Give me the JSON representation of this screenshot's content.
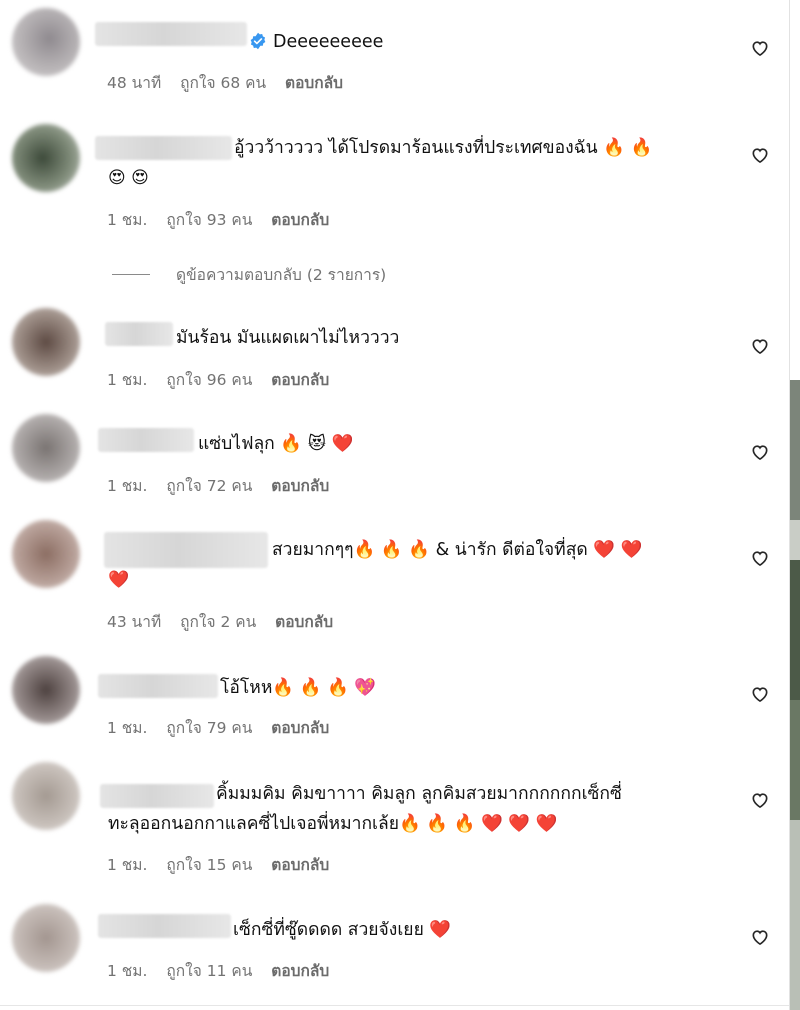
{
  "comments": [
    {
      "username_blurred": true,
      "verified": true,
      "text": "Deeeeeeeee",
      "emojis": "",
      "time": "48 นาที",
      "likes": "ถูกใจ 68 คน",
      "reply": "ตอบกลับ"
    },
    {
      "username_blurred": true,
      "verified": false,
      "text": "อู้ววว้าวววว ได้โปรดมาร้อนแรงที่ประเทศของฉัน 🔥 🔥",
      "emojis": "😍 😍",
      "time": "1 ชม.",
      "likes": "ถูกใจ 93 คน",
      "reply": "ตอบกลับ"
    },
    {
      "username_blurred": true,
      "verified": false,
      "text": "มันร้อน มันแผดเผาไม่ไหวววว",
      "emojis": "",
      "time": "1 ชม.",
      "likes": "ถูกใจ 96 คน",
      "reply": "ตอบกลับ"
    },
    {
      "username_blurred": true,
      "verified": false,
      "text": "แซ่บไฟลุก 🔥 😻 ❤️",
      "emojis": "",
      "time": "1 ชม.",
      "likes": "ถูกใจ 72 คน",
      "reply": "ตอบกลับ"
    },
    {
      "username_blurred": true,
      "verified": false,
      "text": "สวยมากๆๆ🔥 🔥 🔥 & น่ารัก ดีต่อใจที่สุด ❤️ ❤️",
      "emojis": "❤️",
      "time": "43 นาที",
      "likes": "ถูกใจ 2 คน",
      "reply": "ตอบกลับ"
    },
    {
      "username_blurred": true,
      "verified": false,
      "text": "โอ้โหห🔥 🔥 🔥 💖",
      "emojis": "",
      "time": "1 ชม.",
      "likes": "ถูกใจ 79 คน",
      "reply": "ตอบกลับ"
    },
    {
      "username_blurred": true,
      "verified": false,
      "text": "คิ้มมมคิม คิมขาาาา คิมลูก ลูกคิมสวยมากกกกกกเซ็กซี่",
      "text2": "ทะลุออกนอกกาแลคซี่ไปเจอพี่หมากเล้ย🔥 🔥 🔥 ❤️ ❤️ ❤️",
      "emojis": "",
      "time": "1 ชม.",
      "likes": "ถูกใจ 15 คน",
      "reply": "ตอบกลับ"
    },
    {
      "username_blurred": true,
      "verified": false,
      "text": "เซ็กซี่ที่ซู๊ดดดด สวยจังเยย ❤️",
      "emojis": "",
      "time": "1 ชม.",
      "likes": "ถูกใจ 11 คน",
      "reply": "ตอบกลับ"
    }
  ],
  "view_replies": "ดูข้อความตอบกลับ (2 รายการ)",
  "icons": {
    "like": "heart-outline-icon",
    "verified": "verified-badge-icon"
  },
  "colors": {
    "verified": "#3897f0",
    "meta": "#737373"
  }
}
